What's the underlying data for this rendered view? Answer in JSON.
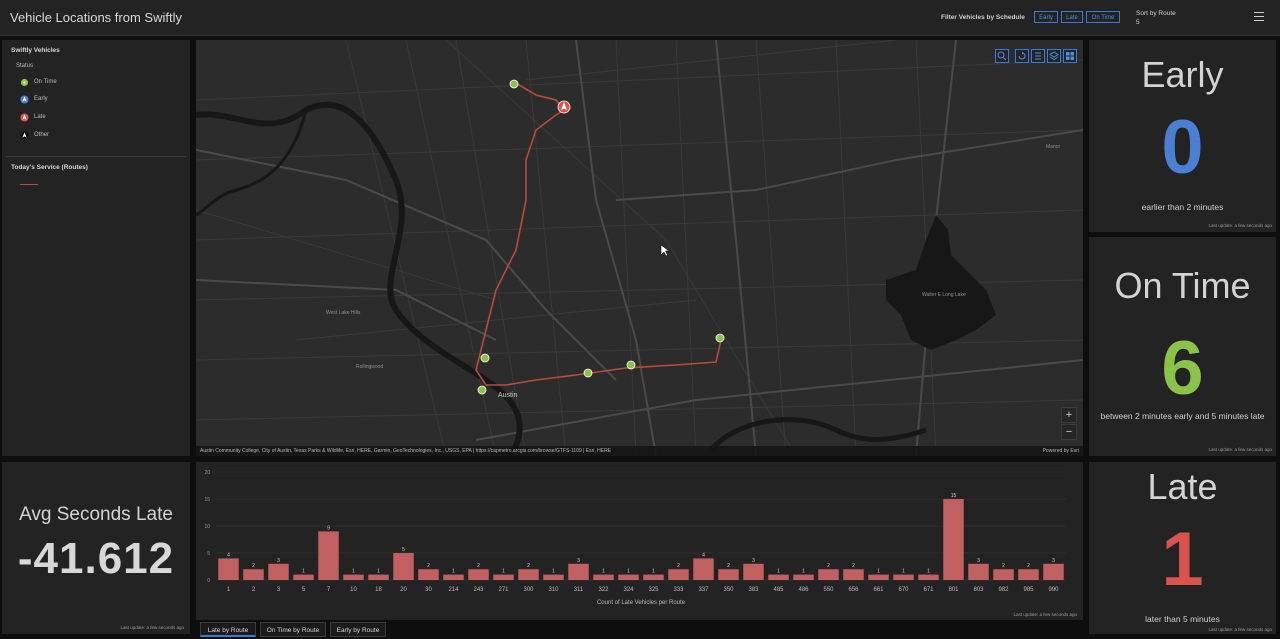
{
  "header": {
    "title": "Vehicle Locations from Swiftly",
    "filter_label": "Filter Vehicles by Schedule",
    "filter_buttons": [
      "Early",
      "Late",
      "On Time"
    ],
    "sort_label": "Sort by Route",
    "sort_value": "5"
  },
  "legend": {
    "title": "Swiftly Vehicles",
    "subtitle": "Status",
    "items": [
      {
        "label": "On Time",
        "color": "#8bc34a",
        "icon": "circle-dot-icon"
      },
      {
        "label": "Early",
        "color": "#4a7fd4",
        "icon": "navigation-arrow-icon"
      },
      {
        "label": "Late",
        "color": "#d9534f",
        "icon": "navigation-arrow-icon"
      },
      {
        "label": "Other",
        "color": "#111111",
        "icon": "navigation-arrow-icon"
      }
    ],
    "routes_title": "Today's Service (Routes)",
    "route_color": "#b84b3c"
  },
  "map": {
    "attribution": "Austin Community College, City of Austin, Texas Parks & Wildlife, Esri, HERE, Garmin, GeoTechnologies, Inc., USGS, EPA | https://capmetro.arcgis.com/browse/GTFS-1109 | Esri, HERE",
    "powered_by": "Powered by Esri",
    "zoom_in": "+",
    "zoom_out": "−",
    "city_label": "Austin",
    "place_labels": [
      "West Lake Hills",
      "Rollingwood",
      "Walter E Long Lake",
      "Manor"
    ],
    "tool_icons": [
      "search-icon",
      "rotate-icon",
      "list-icon",
      "layers-icon",
      "basemap-icon"
    ]
  },
  "indicators": {
    "early": {
      "title": "Early",
      "value": "0",
      "desc": "earlier than 2 minutes",
      "color": "#4a7fd4",
      "updated": "Last update: a few seconds ago"
    },
    "on_time": {
      "title": "On Time",
      "value": "6",
      "desc": "between 2 minutes early and 5 minutes late",
      "color": "#8bc34a",
      "updated": "Last update: a few seconds ago"
    },
    "late": {
      "title": "Late",
      "value": "1",
      "desc": "later than 5 minutes",
      "color": "#d9534f",
      "updated": "Last update: a few seconds ago"
    }
  },
  "avg": {
    "label": "Avg Seconds Late",
    "value": "-41.612",
    "updated": "Last update: a few seconds ago"
  },
  "chart_data": {
    "type": "bar",
    "title": "",
    "xlabel": "Count of Late Vehicles per Route",
    "ylabel": "",
    "ylim": [
      0,
      20
    ],
    "yticks": [
      0,
      5,
      10,
      15,
      20
    ],
    "categories": [
      "1",
      "2",
      "3",
      "5",
      "7",
      "10",
      "18",
      "20",
      "30",
      "214",
      "243",
      "271",
      "300",
      "310",
      "311",
      "322",
      "324",
      "325",
      "333",
      "337",
      "350",
      "383",
      "485",
      "486",
      "550",
      "656",
      "661",
      "670",
      "671",
      "801",
      "803",
      "982",
      "985",
      "990"
    ],
    "values": [
      4,
      2,
      3,
      1,
      9,
      1,
      1,
      5,
      2,
      1,
      2,
      1,
      2,
      1,
      3,
      1,
      1,
      1,
      2,
      4,
      2,
      3,
      1,
      1,
      2,
      2,
      1,
      1,
      1,
      15,
      3,
      2,
      2,
      3
    ],
    "bar_color": "#c06060",
    "updated": "Last update: a few seconds ago"
  },
  "tabs": [
    "Late by Route",
    "On Time by Route",
    "Early by Route"
  ]
}
